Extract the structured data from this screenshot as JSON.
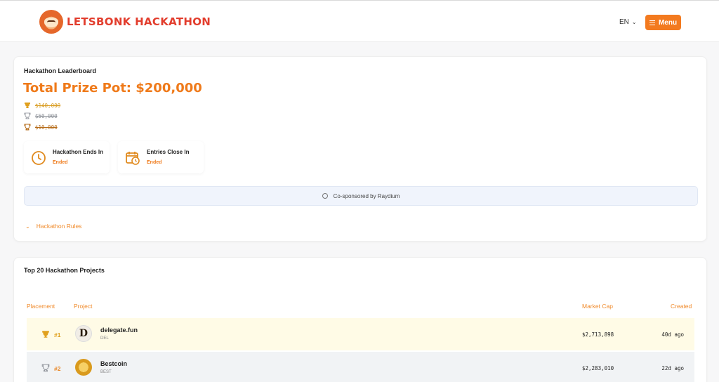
{
  "header": {
    "brand": "LETSBONK HACKATHON",
    "lang": "EN",
    "menu_label": "Menu"
  },
  "leaderboard": {
    "title": "Hackathon Leaderboard",
    "prize_pot": "Total Prize Pot: $200,000",
    "prizes": [
      {
        "amount": "$140,000",
        "icon": "gold-trophy-icon",
        "color": "#d89a1c"
      },
      {
        "amount": "$50,000",
        "icon": "silver-trophy-icon",
        "color": "#8b8f96"
      },
      {
        "amount": "$10,000",
        "icon": "bronze-trophy-icon",
        "color": "#b56b18"
      }
    ],
    "stats": [
      {
        "label": "Hackathon Ends In",
        "value": "Ended",
        "icon": "clock-icon"
      },
      {
        "label": "Entries Close In",
        "value": "Ended",
        "icon": "calendar-clock-icon"
      }
    ],
    "sponsor": "Co-sponsored by Raydium",
    "rules_label": "Hackathon Rules"
  },
  "projects": {
    "title": "Top 20 Hackathon Projects",
    "columns": {
      "placement": "Placement",
      "project": "Project",
      "market_cap": "Market Cap",
      "created": "Created"
    },
    "rows": [
      {
        "rank": "#1",
        "name": "delegate.fun",
        "ticker": "DEL",
        "market_cap": "$2,713,898",
        "created": "40d ago",
        "avatar_letter": "D"
      },
      {
        "rank": "#2",
        "name": "Bestcoin",
        "ticker": "BEST",
        "market_cap": "$2,283,010",
        "created": "22d ago",
        "avatar_letter": ""
      }
    ]
  },
  "colors": {
    "accent": "#ef7a1a",
    "brand": "#e23d2d",
    "menu_button": "#f37a1f",
    "first_row_bg": "#fffbe6",
    "second_row_bg": "#f1f3f5"
  }
}
